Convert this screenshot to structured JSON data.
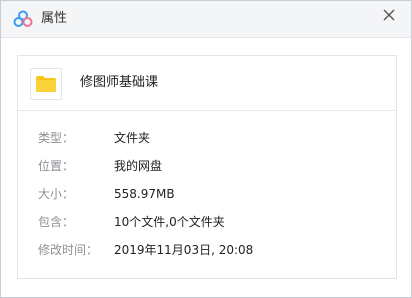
{
  "window": {
    "title": "属性",
    "app_icon": "baidu-netdisk-icon",
    "close_icon": "close-icon"
  },
  "file": {
    "icon": "folder-icon",
    "name": "修图师基础课"
  },
  "properties": [
    {
      "label": "类型：",
      "value": "文件夹"
    },
    {
      "label": "位置：",
      "value": "我的网盘"
    },
    {
      "label": "大小：",
      "value": "558.97MB"
    },
    {
      "label": "包含：",
      "value": "10个文件,0个文件夹"
    },
    {
      "label": "修改时间：",
      "value": "2019年11月03日, 20:08"
    }
  ],
  "colors": {
    "folder": "#f9c51a",
    "accent_blue": "#3a9cf5",
    "accent_pink": "#f5739b"
  }
}
